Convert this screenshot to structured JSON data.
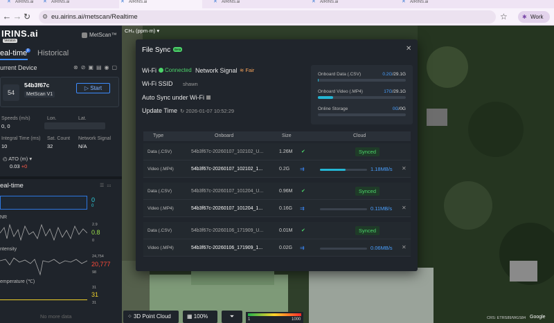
{
  "browser": {
    "tabs": [
      "AIRINS.ai",
      "AIRINS.ai",
      "AIRINS.ai",
      "AIRINS.ai",
      "AIRINS.ai",
      "AIRINS.ai"
    ],
    "url": "eu.airins.ai/metscan/Realtime",
    "profile": "Work"
  },
  "sidebar": {
    "logo": "IRINS.ai",
    "version": "Version",
    "product": "MetScan™",
    "tab_realtime": "eal-time",
    "tab_realtime_badge": "β",
    "tab_historical": "Historical",
    "current_device": "urrent Device",
    "device": {
      "num": "54",
      "id": "54b3f67c",
      "model": "MetScan V1",
      "start": "Start"
    },
    "stats": {
      "speeds_label": "Speeds (m/s)",
      "speeds_value": "0, 0",
      "lon_label": "Lon.",
      "lat_label": "Lat.",
      "integral_label": "Integral Time (ms)",
      "integral_value": "10",
      "sat_label": "Sat. Count",
      "sat_value": "32",
      "net_label": "Network Signal",
      "net_value": "N/A"
    },
    "ato_label": "ATO (m)",
    "ato_value": "0.03",
    "ato_delta": "+0",
    "realtime_section": "eal-time",
    "series": [
      {
        "label": "",
        "value": "0",
        "max": "",
        "min": "",
        "color": "#2fd2e0"
      },
      {
        "label": "NR",
        "value": "0.8",
        "max": "2.9",
        "min": "0",
        "color": "#9be04a"
      },
      {
        "label": "ntensity",
        "value": "20,777",
        "max": "24,754",
        "min": "98",
        "color": "#ff4a3a"
      },
      {
        "label": "emperature (℃)",
        "value": "31",
        "max": "31",
        "min": "31",
        "color": "#f0d02a"
      }
    ],
    "no_more": "No more data"
  },
  "map": {
    "layer_label": "CH₄ (ppm·m)",
    "toolbar": {
      "point_cloud": "3D Point Cloud",
      "opacity": "100%"
    },
    "legend": {
      "min": "1",
      "max": "1000"
    },
    "crs": "CRS: ETRS89/WGS84",
    "google": "Google"
  },
  "dialog": {
    "title": "File Sync",
    "badge": "Beta",
    "wifi_label": "Wi-Fi",
    "wifi_status": "Connected",
    "net_label": "Network Signal",
    "net_status": "Fair",
    "ssid_label": "Wi-Fi SSID",
    "ssid_value": "shawn",
    "auto_sync_label": "Auto Sync under Wi-Fi",
    "update_label": "Update Time",
    "update_value": "2026-01-07 10:52:29",
    "storage": [
      {
        "label": "Onboard Data (.CSV)",
        "used": "0.2G",
        "total": "/29.1G",
        "fraction": 0.01
      },
      {
        "label": "Onboard Video (.MP4)",
        "used": "17G",
        "total": "/29.1G",
        "fraction": 0.17
      },
      {
        "label": "Online Storage",
        "used": "0G",
        "total": "/0G",
        "fraction": 0
      }
    ],
    "table": {
      "headers": {
        "type": "Type",
        "onboard": "Onboard",
        "size": "Size",
        "cloud": "Cloud"
      },
      "rows": [
        {
          "type": "Data (.CSV)",
          "file": "54b3f67c-20260107_102102_U...",
          "size": "1.26M",
          "kind": "csv",
          "status": "Synced"
        },
        {
          "type": "Video (.MP4)",
          "file": "54b3f67c-20260107_102102_1...",
          "size": "0.2G",
          "kind": "mp4",
          "rate": "1.18MB/s",
          "progress": 0.55
        },
        {
          "type": "Data (.CSV)",
          "file": "54b3f67c-20260107_101204_U...",
          "size": "0.96M",
          "kind": "csv",
          "status": "Synced"
        },
        {
          "type": "Video (.MP4)",
          "file": "54b3f67c-20260107_101204_1...",
          "size": "0.16G",
          "kind": "mp4",
          "rate": "0.11MB/s",
          "progress": 0.0
        },
        {
          "type": "Data (.CSV)",
          "file": "54b3f67c-20260106_171909_U...",
          "size": "0.01M",
          "kind": "csv",
          "status": "Synced"
        },
        {
          "type": "Video (.MP4)",
          "file": "54b3f67c-20260106_171909_1...",
          "size": "0.02G",
          "kind": "mp4",
          "rate": "0.06MB/s",
          "progress": 0.0
        }
      ]
    }
  }
}
